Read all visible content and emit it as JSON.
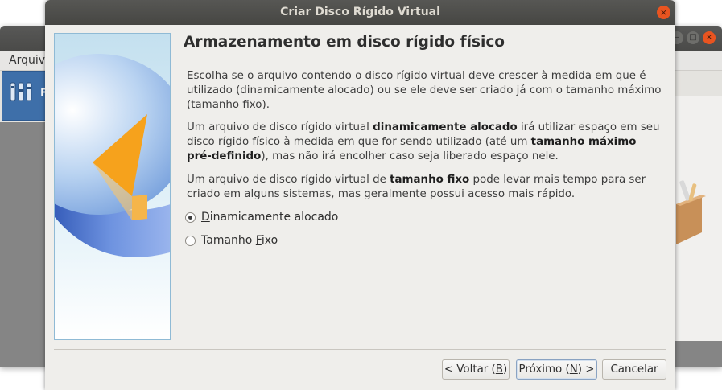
{
  "background_window": {
    "menu": [
      "Arquivo"
    ],
    "toolbar_item_initial": "F",
    "window_buttons": [
      "–",
      "□",
      "×"
    ]
  },
  "dialog": {
    "title": "Criar Disco Rígido Virtual",
    "close_glyph": "×",
    "page_title": "Armazenamento em disco rígido físico",
    "paragraphs": {
      "p1": "Escolha se o arquivo contendo o disco rígido virtual deve crescer à medida em que é utilizado (dinamicamente alocado) ou se ele deve ser criado já com o tamanho máximo (tamanho fixo).",
      "p2_a": "Um arquivo de disco rígido virtual ",
      "p2_b": "dinamicamente alocado",
      "p2_c": " irá utilizar espaço em seu disco rígido físico à medida em que for sendo utilizado (até um ",
      "p2_d": "tamanho máximo pré-definido",
      "p2_e": "), mas não irá encolher caso seja liberado espaço nele.",
      "p3_a": "Um arquivo de disco rígido virtual de ",
      "p3_b": "tamanho fixo",
      "p3_c": " pode levar mais tempo para ser criado em alguns sistemas, mas geralmente possui acesso mais rápido."
    },
    "options": [
      {
        "label_pre": "",
        "label_mnemonic": "D",
        "label_post": "inamicamente alocado",
        "checked": true
      },
      {
        "label_pre": "Tamanho ",
        "label_mnemonic": "F",
        "label_post": "ixo",
        "checked": false
      }
    ],
    "buttons": {
      "back_pre": "< Voltar (",
      "back_mnemonic": "B",
      "back_post": ")",
      "next_pre": "Próximo (",
      "next_mnemonic": "N",
      "next_post": ") >",
      "cancel": "Cancelar"
    }
  },
  "colors": {
    "accent_close": "#e95420",
    "selection_blue": "#3e6fa9",
    "dialog_bg": "#efeeeb"
  }
}
